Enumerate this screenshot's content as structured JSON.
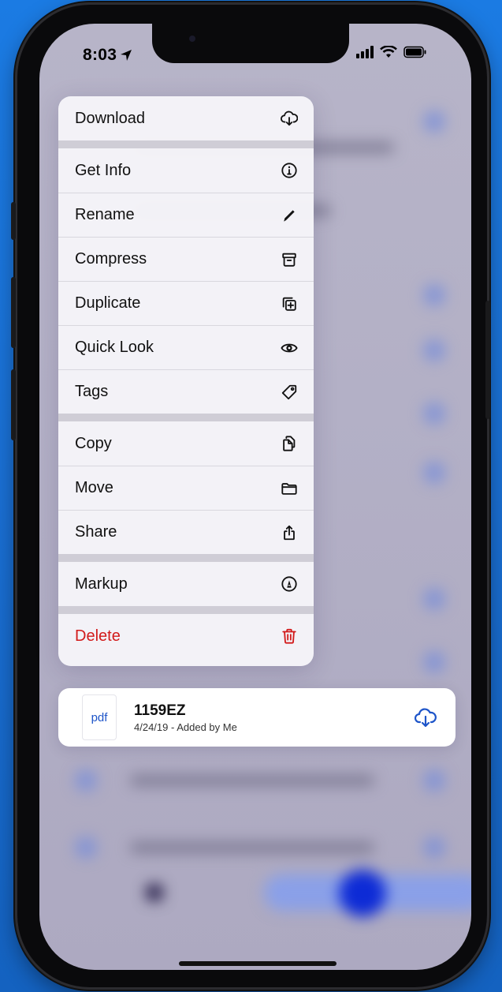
{
  "status_bar": {
    "time": "8:03"
  },
  "menu": {
    "groups": [
      [
        {
          "label": "Download",
          "icon": "cloud-download-icon"
        }
      ],
      [
        {
          "label": "Get Info",
          "icon": "info-circle-icon"
        },
        {
          "label": "Rename",
          "icon": "pencil-icon"
        },
        {
          "label": "Compress",
          "icon": "archive-box-icon"
        },
        {
          "label": "Duplicate",
          "icon": "duplicate-plus-icon"
        },
        {
          "label": "Quick Look",
          "icon": "eye-icon"
        },
        {
          "label": "Tags",
          "icon": "tag-icon"
        }
      ],
      [
        {
          "label": "Copy",
          "icon": "copy-document-icon"
        },
        {
          "label": "Move",
          "icon": "folder-icon"
        },
        {
          "label": "Share",
          "icon": "share-icon"
        }
      ],
      [
        {
          "label": "Markup",
          "icon": "markup-pen-icon"
        }
      ],
      [
        {
          "label": "Delete",
          "icon": "trash-icon",
          "destructive": true
        }
      ]
    ]
  },
  "file": {
    "thumb_label": "pdf",
    "name": "1159EZ",
    "meta": "4/24/19 - Added by Me"
  },
  "colors": {
    "accent": "#1e55c9",
    "destructive": "#d21a1a",
    "menu_bg": "#f6f5f9",
    "backdrop": "#b4b1c6"
  }
}
